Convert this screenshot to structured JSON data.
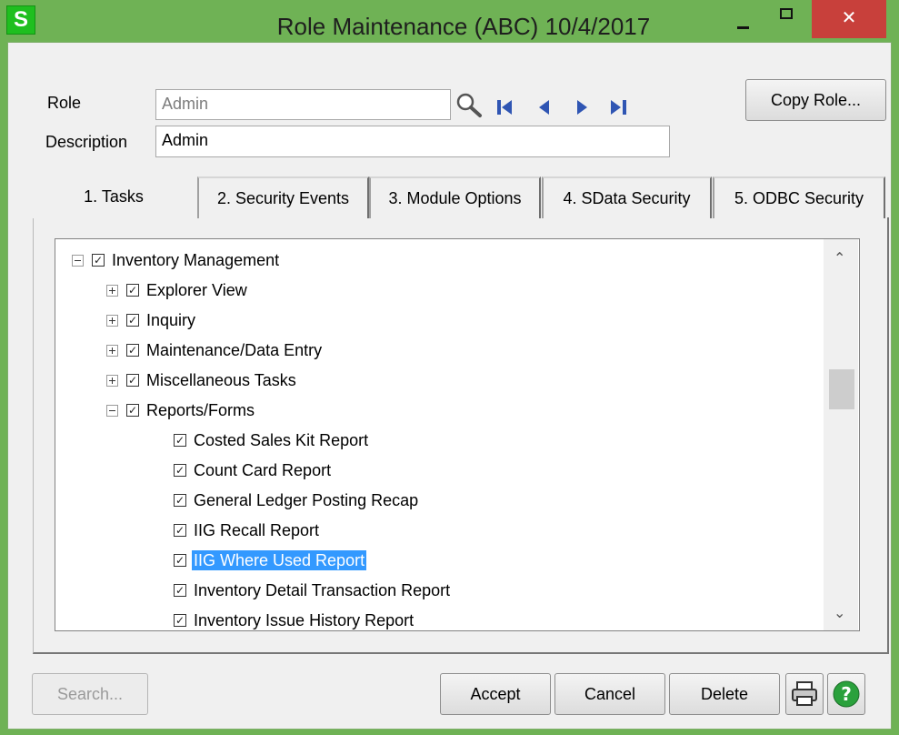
{
  "window": {
    "title": "Role Maintenance (ABC) 10/4/2017",
    "app_icon_letter": "S",
    "close_glyph": "✕"
  },
  "form": {
    "role_label": "Role",
    "role_value": "Admin",
    "description_label": "Description",
    "description_value": "Admin",
    "copy_role_button": "Copy Role..."
  },
  "tabs": [
    {
      "label": "1. Tasks",
      "active": true
    },
    {
      "label": "2. Security Events",
      "active": false
    },
    {
      "label": "3. Module Options",
      "active": false
    },
    {
      "label": "4. SData Security",
      "active": false
    },
    {
      "label": "5. ODBC Security",
      "active": false
    }
  ],
  "tree": {
    "items": [
      {
        "label": "Inventory Management",
        "expander": "minus",
        "checked": true
      },
      {
        "label": "Explorer View",
        "expander": "plus",
        "checked": true
      },
      {
        "label": "Inquiry",
        "expander": "plus",
        "checked": true
      },
      {
        "label": "Maintenance/Data Entry",
        "expander": "plus",
        "checked": true
      },
      {
        "label": "Miscellaneous Tasks",
        "expander": "plus",
        "checked": true
      },
      {
        "label": "Reports/Forms",
        "expander": "minus",
        "checked": true
      },
      {
        "label": "Costed Sales Kit Report",
        "checked": true
      },
      {
        "label": "Count Card Report",
        "checked": true
      },
      {
        "label": "General Ledger Posting Recap",
        "checked": true
      },
      {
        "label": "IIG Recall Report",
        "checked": true
      },
      {
        "label": "IIG Where Used Report",
        "checked": true,
        "selected": true
      },
      {
        "label": "Inventory Detail Transaction Report",
        "checked": true
      },
      {
        "label": "Inventory Issue History Report",
        "checked": true
      }
    ],
    "check_glyph": "✓"
  },
  "buttons": {
    "search": "Search...",
    "accept": "Accept",
    "cancel": "Cancel",
    "delete": "Delete"
  },
  "icons": {
    "lookup": "magnifier-icon",
    "first": "first-record-icon",
    "previous": "previous-record-icon",
    "next": "next-record-icon",
    "last": "last-record-icon",
    "print": "printer-icon",
    "help": "help-icon"
  },
  "colors": {
    "title_bar": "#6fb255",
    "close_button": "#c8403b",
    "nav_arrows": "#2f55b3",
    "selection": "#3399ff",
    "help_icon": "#2aa13c"
  }
}
